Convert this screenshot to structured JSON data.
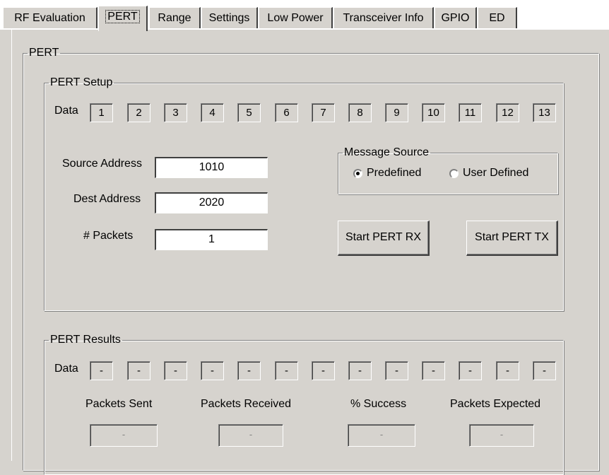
{
  "tabs": [
    "RF Evaluation",
    "PERT",
    "Range",
    "Settings",
    "Low Power",
    "Transceiver Info",
    "GPIO",
    "ED"
  ],
  "active_tab": "PERT",
  "pert_group_label": "PERT",
  "setup": {
    "label": "PERT Setup",
    "data_label": "Data",
    "data_values": [
      "1",
      "2",
      "3",
      "4",
      "5",
      "6",
      "7",
      "8",
      "9",
      "10",
      "11",
      "12",
      "13"
    ],
    "source_address_label": "Source Address",
    "source_address": "1010",
    "dest_address_label": "Dest Address",
    "dest_address": "2020",
    "packets_label": "# Packets",
    "packets": "1",
    "message_source_label": "Message Source",
    "predefined_label": "Predefined",
    "user_defined_label": "User Defined",
    "start_rx_label": "Start PERT RX",
    "start_tx_label": "Start PERT TX"
  },
  "results": {
    "label": "PERT Results",
    "data_label": "Data",
    "data_values": [
      "-",
      "-",
      "-",
      "-",
      "-",
      "-",
      "-",
      "-",
      "-",
      "-",
      "-",
      "-",
      "-"
    ],
    "packets_sent_label": "Packets Sent",
    "packets_sent": "-",
    "packets_received_label": "Packets Received",
    "packets_received": "-",
    "success_label": "% Success",
    "success": "-",
    "packets_expected_label": "Packets Expected",
    "packets_expected": "-"
  }
}
